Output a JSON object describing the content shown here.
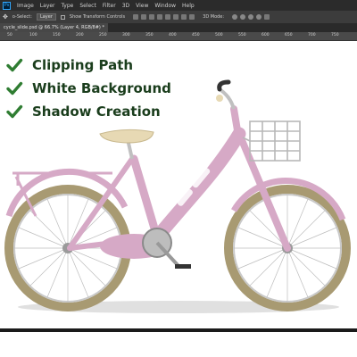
{
  "menubar": {
    "items": [
      "Image",
      "Layer",
      "Type",
      "Select",
      "Filter",
      "3D",
      "View",
      "Window",
      "Help"
    ]
  },
  "options_bar": {
    "auto_select": "o-Select:",
    "layer_dropdown": "Layer",
    "show_transform": "Show Transform Controls",
    "mode_3d": "3D Mode:"
  },
  "document_tab": {
    "title": "cycle_slide.psd @ 66.7% (Layer 4, RGB/8#) *"
  },
  "ruler": {
    "ticks": [
      "50",
      "100",
      "150",
      "200",
      "250",
      "300",
      "350",
      "400",
      "450",
      "500",
      "550",
      "600",
      "650",
      "700",
      "750"
    ]
  },
  "features": [
    {
      "label": "Clipping Path",
      "icon": "check-icon"
    },
    {
      "label": "White Background",
      "icon": "check-icon"
    },
    {
      "label": "Shadow Creation",
      "icon": "check-icon"
    }
  ],
  "colors": {
    "check": "#2f7d32",
    "feature_text": "#1a3d1c",
    "bike_frame": "#d6a9c6",
    "tire": "#a89a72",
    "saddle": "#e7d9b4"
  }
}
